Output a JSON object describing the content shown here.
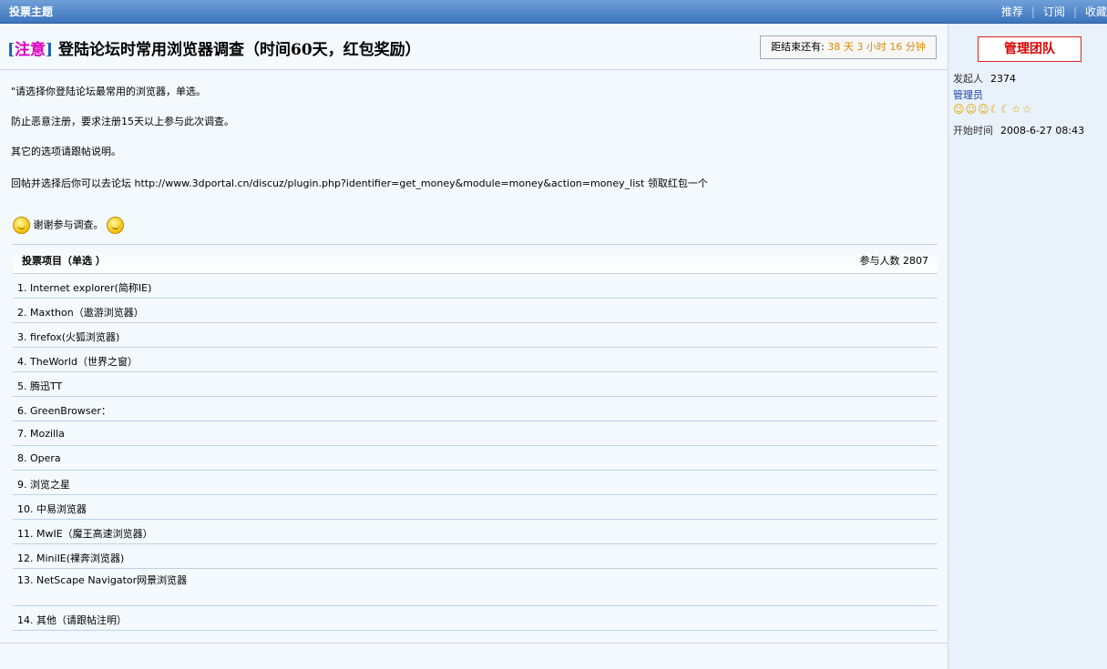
{
  "topbar": {
    "title": "投票主题",
    "actions": [
      "推荐",
      "订阅",
      "收藏"
    ]
  },
  "thread": {
    "tag_open": "[",
    "tag_text": "注意",
    "tag_close": "]",
    "title": "登陆论坛时常用浏览器调查（时间60天，红包奖励）",
    "countdown": {
      "prefix": "距结束还有:",
      "days": "38 天",
      "hours": "3 小时",
      "minutes": "16 分钟"
    },
    "paragraphs": [
      "\"请选择你登陆论坛最常用的浏览器，单选。",
      "防止恶意注册，要求注册15天以上参与此次调查。",
      "其它的选项请跟帖说明。",
      "回帖并选择后你可以去论坛  http://www.3dportal.cn/discuz/plugin.php?identifier=get_money&module=money&action=money_list 领取红包一个"
    ],
    "thanks": "谢谢参与调查。"
  },
  "poll": {
    "header_label": "投票项目（单选 ）",
    "participants": "参与人数  2807",
    "options": [
      "1.  Internet explorer(简称IE)",
      "2.  Maxthon（遨游浏览器）",
      "3.  firefox(火狐浏览器)",
      "4.  TheWorld（世界之窗）",
      "5.  腾迅TT",
      "6.  GreenBrowser：",
      "7.  Mozilla",
      "8.  Opera",
      "9.  浏览之星",
      "10.  中易浏览器",
      "11.  MwIE（魔王高速浏览器）",
      "12.  MiniIE(裸奔浏览器)",
      "13.  NetScape Navigator网景浏览器",
      "14.  其他（请跟帖注明）"
    ]
  },
  "sidebar": {
    "badge": "管理团队",
    "starter_label": "发起人",
    "starter_value": "2374",
    "role": "管理员",
    "start_label": "开始时间",
    "start_value": "2008-6-27 08:43"
  }
}
